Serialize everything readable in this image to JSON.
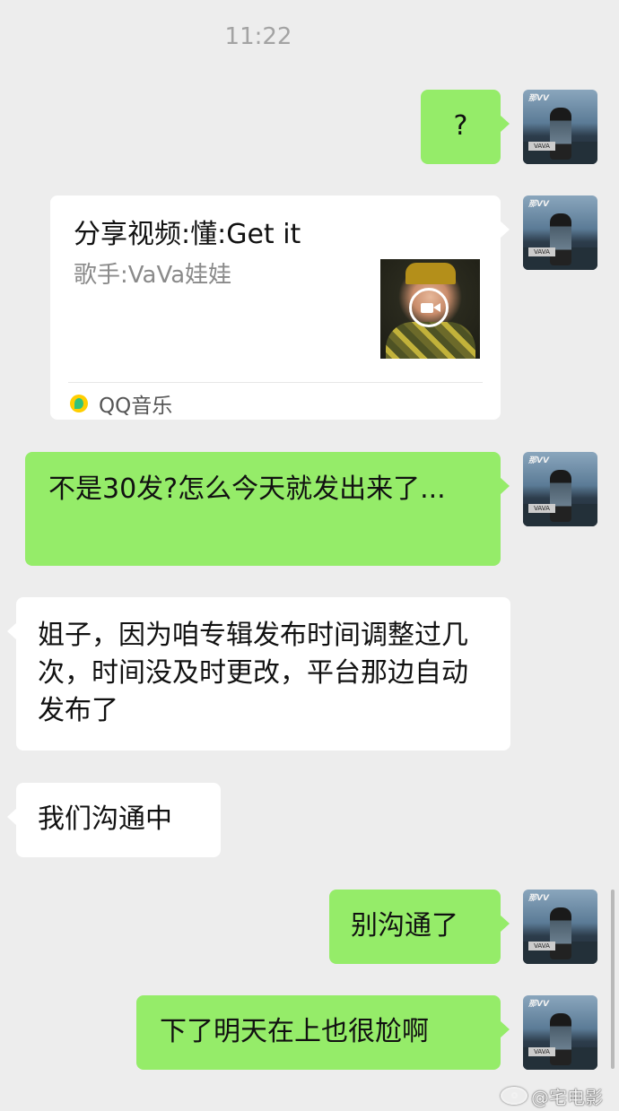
{
  "chat": {
    "timestamp": "11:22",
    "messages": [
      {
        "direction": "outgoing",
        "type": "text",
        "text": "?"
      },
      {
        "direction": "outgoing",
        "type": "share-card",
        "title": "分享视频:懂:Get it",
        "desc": "歌手:VaVa娃娃",
        "source": "QQ音乐"
      },
      {
        "direction": "outgoing",
        "type": "text",
        "text": "不是30发?怎么今天就发出来了..."
      },
      {
        "direction": "incoming",
        "type": "text",
        "text": "姐子，因为咱专辑发布时间调整过几次，时间没及时更改，平台那边自动发布了"
      },
      {
        "direction": "incoming",
        "type": "text",
        "text": "我们沟通中"
      },
      {
        "direction": "outgoing",
        "type": "text",
        "text": "别沟通了"
      },
      {
        "direction": "outgoing",
        "type": "text",
        "text": "下了明天在上也很尬啊"
      }
    ]
  },
  "watermark": {
    "handle": "@宅电影"
  },
  "colors": {
    "background": "#ededed",
    "outgoing_bubble": "#95ec69",
    "incoming_bubble": "#ffffff",
    "timestamp": "#a3a3a3"
  },
  "icons": [
    "avatar-image",
    "video-play-icon",
    "qq-music-icon",
    "weibo-icon"
  ]
}
